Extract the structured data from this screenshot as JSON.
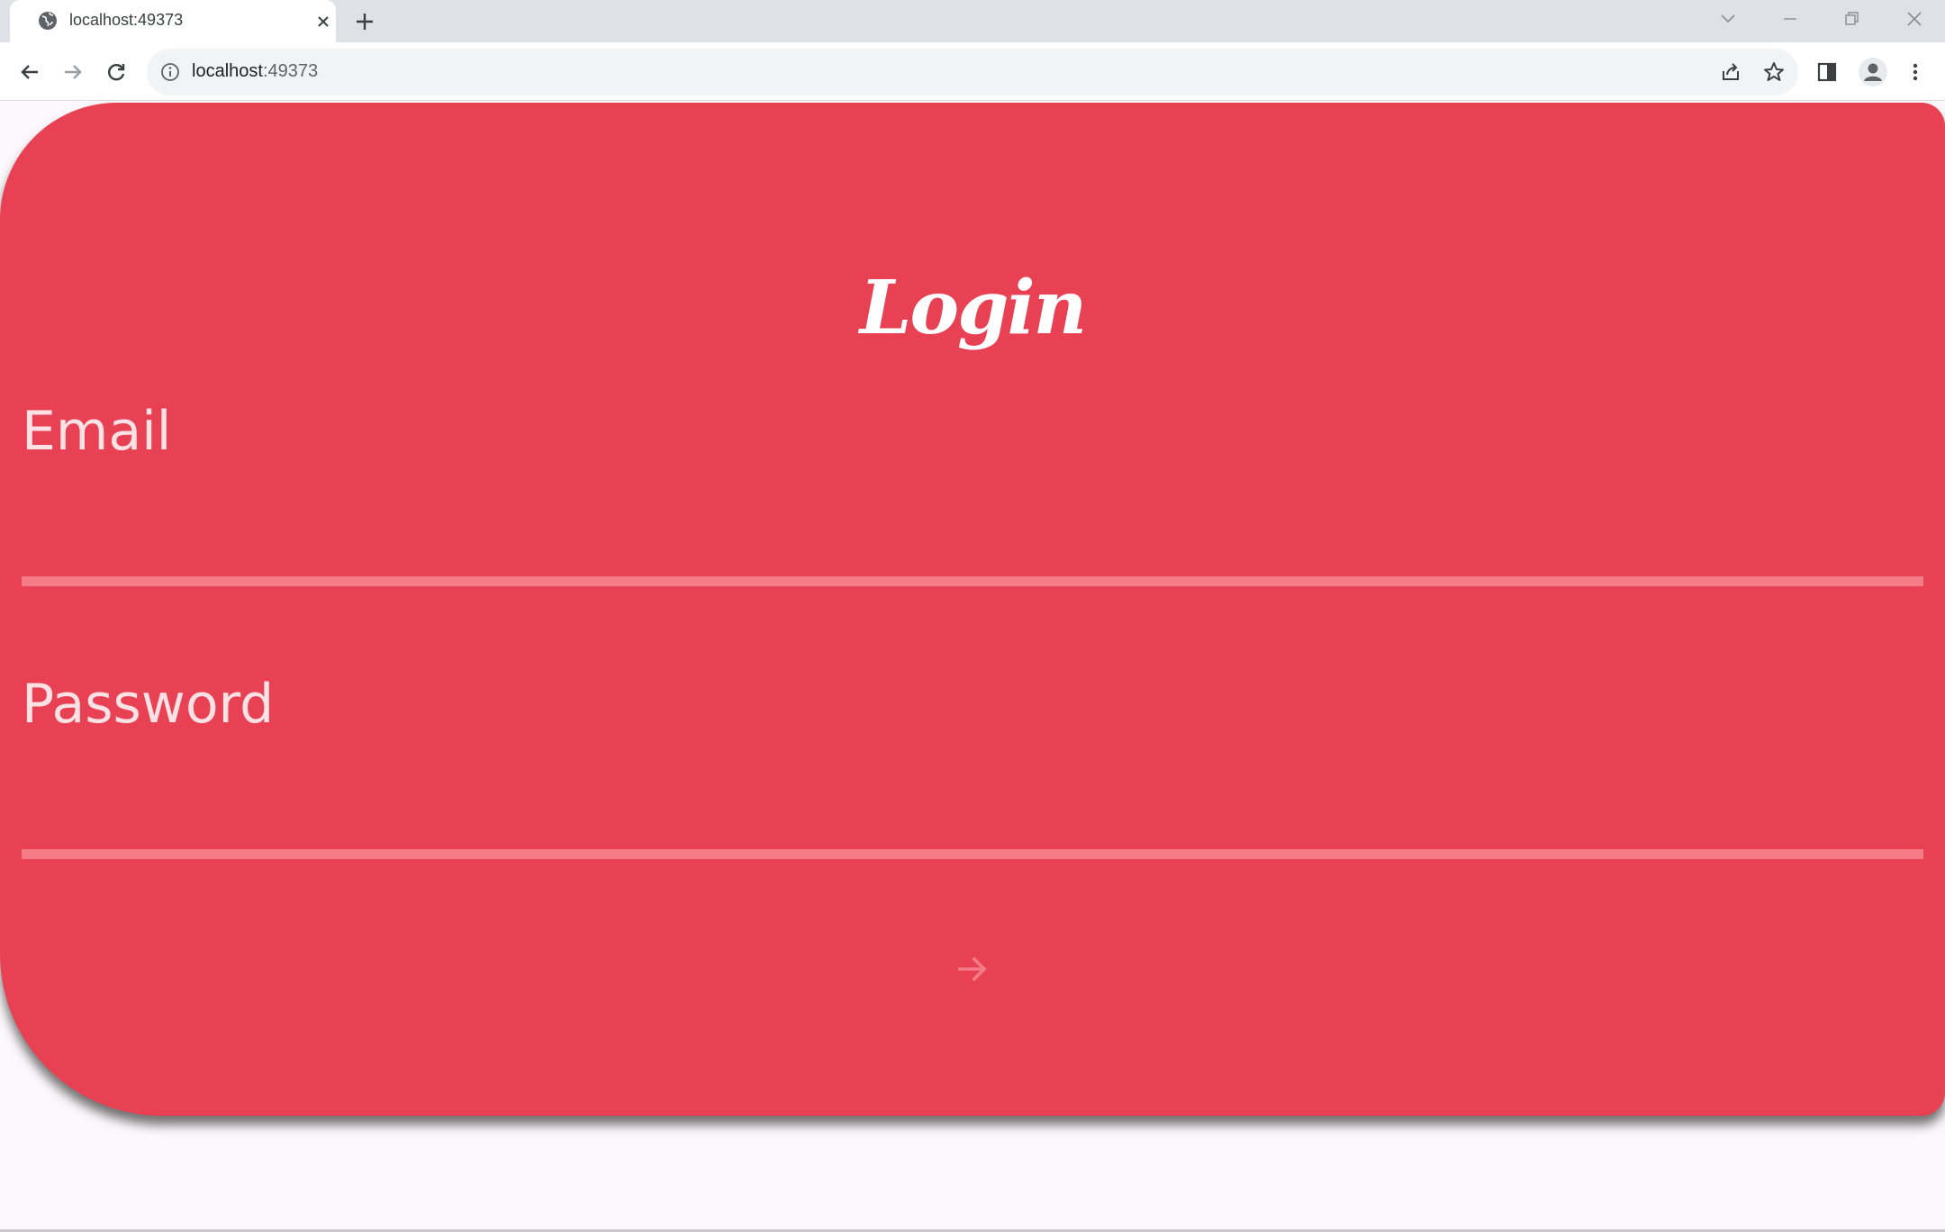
{
  "browser": {
    "tab_title": "localhost:49373",
    "url_host": "localhost",
    "url_port": ":49373",
    "icons": {
      "favicon": "globe-icon",
      "tab_close": "close-icon",
      "new_tab": "plus-icon",
      "tab_search": "chevron-down-icon",
      "minimize": "minimize-icon",
      "restore": "restore-icon",
      "close_window": "close-icon",
      "back": "arrow-left-icon",
      "forward": "arrow-right-icon",
      "reload": "reload-icon",
      "site_info": "info-icon",
      "share": "share-icon",
      "bookmark": "star-icon",
      "side_panel": "side-panel-icon",
      "profile": "profile-icon",
      "menu": "kebab-menu-icon"
    }
  },
  "page": {
    "title": "Login",
    "email_label": "Email",
    "email_value": "",
    "password_label": "Password",
    "password_value": "",
    "submit_icon": "arrow-right-icon"
  },
  "colors": {
    "card_background": "#e84154",
    "underline": "#f47b87",
    "label": "#fde1e4",
    "title": "#ffffff",
    "page_background": "#fdf8fb",
    "submit_icon": "#f47b87"
  }
}
